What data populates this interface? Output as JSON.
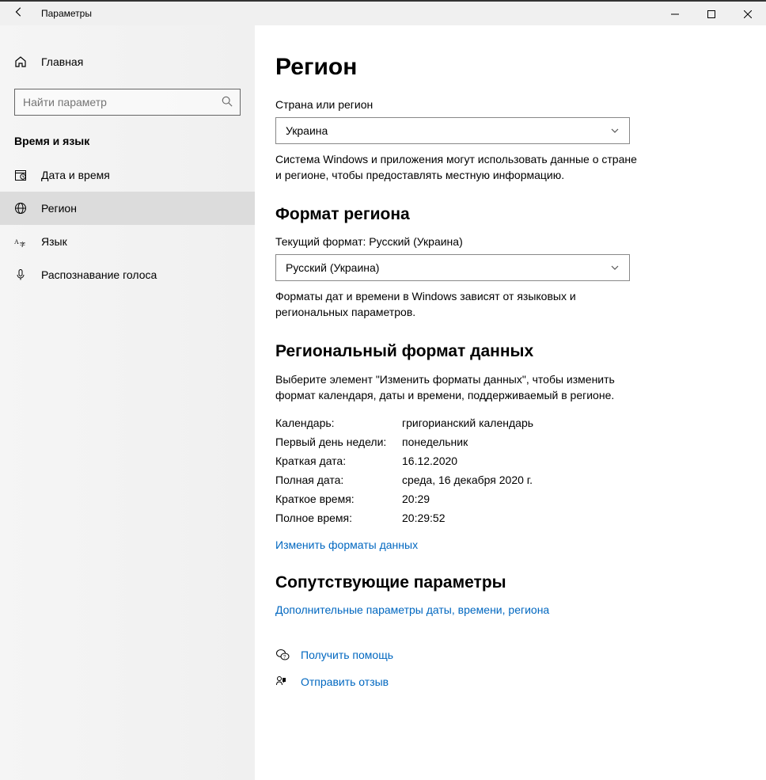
{
  "window": {
    "title": "Параметры"
  },
  "sidebar": {
    "home": "Главная",
    "search_placeholder": "Найти параметр",
    "section": "Время и язык",
    "items": [
      {
        "label": "Дата и время"
      },
      {
        "label": "Регион"
      },
      {
        "label": "Язык"
      },
      {
        "label": "Распознавание голоса"
      }
    ]
  },
  "main": {
    "title": "Регион",
    "country": {
      "label": "Страна или регион",
      "value": "Украина",
      "desc": "Система Windows и приложения могут использовать данные о стране и регионе, чтобы предоставлять местную информацию."
    },
    "format": {
      "heading": "Формат региона",
      "current_label": "Текущий формат: Русский (Украина)",
      "value": "Русский (Украина)",
      "desc": "Форматы дат и времени в Windows зависят от языковых и региональных параметров."
    },
    "regional": {
      "heading": "Региональный формат данных",
      "desc": "Выберите элемент \"Изменить форматы данных\", чтобы изменить формат календаря, даты и времени, поддерживаемый в регионе.",
      "rows": [
        {
          "k": "Календарь:",
          "v": "григорианский календарь"
        },
        {
          "k": "Первый день недели:",
          "v": "понедельник"
        },
        {
          "k": "Краткая дата:",
          "v": "16.12.2020"
        },
        {
          "k": "Полная дата:",
          "v": "среда, 16 декабря 2020 г."
        },
        {
          "k": "Краткое время:",
          "v": "20:29"
        },
        {
          "k": "Полное время:",
          "v": "20:29:52"
        }
      ],
      "change_link": "Изменить форматы данных"
    },
    "related": {
      "heading": "Сопутствующие параметры",
      "link": "Дополнительные параметры даты, времени, региона"
    },
    "help": "Получить помощь",
    "feedback": "Отправить отзыв"
  }
}
